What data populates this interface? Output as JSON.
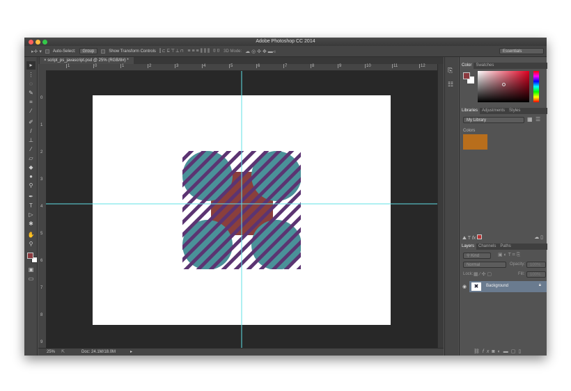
{
  "window": {
    "title": "Adobe Photoshop CC 2014"
  },
  "options": {
    "auto_select_label": "Auto-Select:",
    "auto_select_value": "Group",
    "show_transform_label": "Show Transform Controls",
    "mode_3d_label": "3D Mode:",
    "workspace": "Essentials"
  },
  "document_tab": {
    "title": "script_ps_javascript.psd @ 25% (RGB/8#) *",
    "close": "×"
  },
  "rulers": {
    "horizontal": [
      "1",
      "0",
      "1",
      "2",
      "3",
      "4",
      "5",
      "6",
      "7",
      "8",
      "9",
      "10",
      "11",
      "12"
    ],
    "vertical": [
      "0",
      "1",
      "2",
      "3",
      "4",
      "5",
      "6",
      "7",
      "8",
      "9"
    ]
  },
  "status": {
    "zoom": "25%",
    "doc": "Doc: 24.1M/18.0M"
  },
  "color_panel": {
    "tabs": [
      "Color",
      "Swatches"
    ],
    "foreground": "#8b3a3f",
    "background": "#ffffff"
  },
  "libraries_panel": {
    "tabs": [
      "Libraries",
      "Adjustments",
      "Styles"
    ],
    "library": "My Library",
    "section": "Colors",
    "swatch": "#b86e1c"
  },
  "layers_panel": {
    "tabs": [
      "Layers",
      "Channels",
      "Paths"
    ],
    "filter": "Kind",
    "blend_mode": "Normal",
    "opacity_label": "Opacity:",
    "opacity": "100%",
    "lock_label": "Lock:",
    "fill_label": "Fill:",
    "fill": "100%",
    "layers": [
      {
        "name": "Background",
        "locked": true
      }
    ]
  },
  "artwork": {
    "circle_color": "#4a9199",
    "cross_color": "#8a3f3c",
    "stripe_color": "#5c3472",
    "guide_color": "#5fe0e6"
  }
}
